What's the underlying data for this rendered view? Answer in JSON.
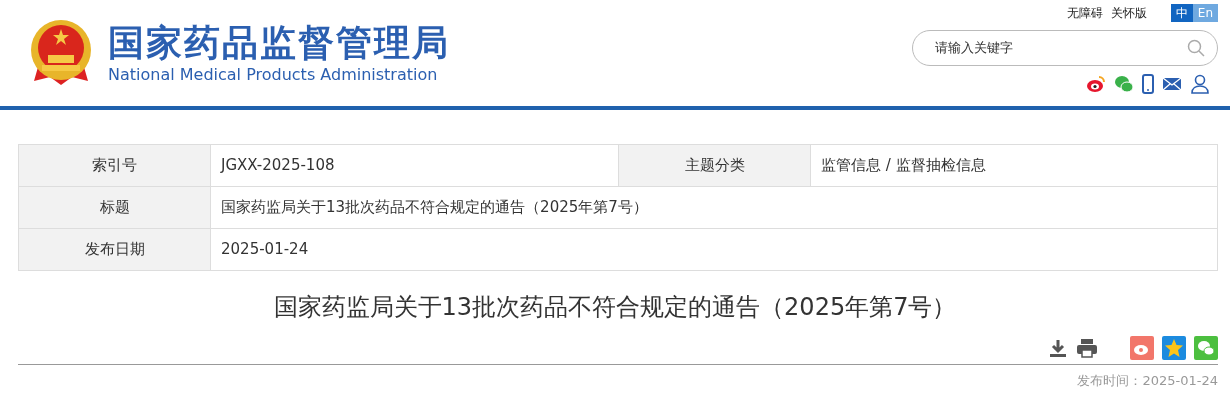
{
  "header": {
    "title": "国家药品监督管理局",
    "subtitle": "National Medical Products Administration",
    "links": [
      "无障碍",
      "关怀版"
    ],
    "languages": [
      {
        "label": "中",
        "selected": true
      },
      {
        "label": "En",
        "selected": false
      }
    ],
    "search": {
      "placeholder": "请输入关键字"
    },
    "social": [
      {
        "kind": "weibo"
      },
      {
        "kind": "wechat"
      },
      {
        "kind": "mobile"
      },
      {
        "kind": "mail"
      },
      {
        "kind": "user"
      }
    ]
  },
  "info_table": {
    "rows": [
      [
        {
          "label": "索引号",
          "value": "JGXX-2025-108"
        },
        {
          "label": "主题分类",
          "value": "监管信息 / 监督抽检信息"
        }
      ],
      [
        {
          "label": "标题",
          "value": "国家药监局关于13批次药品不符合规定的通告（2025年第7号）"
        }
      ],
      [
        {
          "label": "发布日期",
          "value": "2025-01-24"
        }
      ]
    ]
  },
  "article": {
    "title": "国家药监局关于13批次药品不符合规定的通告（2025年第7号）",
    "tools": [
      {
        "kind": "download"
      },
      {
        "kind": "print"
      }
    ],
    "share": [
      {
        "kind": "weibo"
      },
      {
        "kind": "qzone"
      },
      {
        "kind": "wechat"
      }
    ],
    "publish_label": "发布时间：",
    "publish_date": "2025-01-24"
  }
}
